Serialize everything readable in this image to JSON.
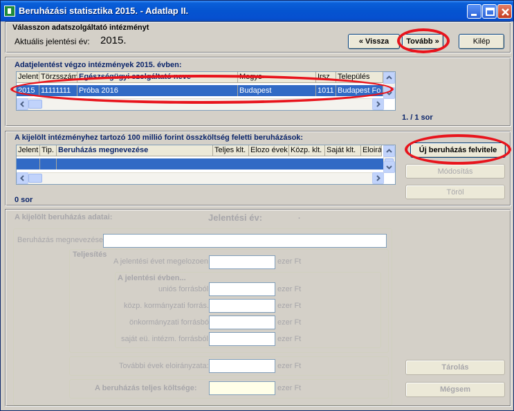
{
  "window": {
    "title": "Beruházási statisztika 2015. - Adatlap II."
  },
  "top": {
    "prompt": "Válasszon adatszolgáltató intézményt",
    "year_label": "Aktuális jelentési év:",
    "year_value": "2015.",
    "back_button": "« Vissza",
    "next_button": "Tovább »",
    "exit_button": "Kilép"
  },
  "institutions": {
    "title": "Adatjelentést végzo intézmények  2015. évben:",
    "columns": [
      "Jelent",
      "Törzsszám",
      "Egészségügyi szolgáltató neve",
      "Megye",
      "Irsz",
      "Település"
    ],
    "rows": [
      [
        "2015",
        "11111111",
        "Próba 2016",
        "Budapest",
        "1011",
        "Budapest Fo"
      ]
    ],
    "count": "1. / 1 sor"
  },
  "investments": {
    "title": "A kijelölt intézményhez tartozó 100 millió forint összköltség feletti beruházások:",
    "columns": [
      "Jelent",
      "Tip.",
      "Beruházás megnevezése",
      "Teljes klt.",
      "Elozo évek",
      "Közp. klt.",
      "Saját klt.",
      "Eloirá"
    ],
    "count": "0 sor",
    "new_button": "Új beruházás felvitele",
    "modify_button": "Módosítás",
    "delete_button": "Töröl"
  },
  "details": {
    "title": "A kijelölt beruházás adatai:",
    "year_label": "Jelentési év:",
    "year_value": ".",
    "name_label": "Beruházás megnevezése:",
    "fulfilment_label": "Teljesítés",
    "prior_label": "A jelentési évet megelozoen:",
    "in_year_label": "A jelentési évben...",
    "eu_label": "uniós forrásból:",
    "central_label": "közp. kormányzati forrás.:",
    "local_label": "önkormányzati forrásból:",
    "own_label": "saját eü. intézm. forrásból:",
    "future_label": "További évek eloirányzata:",
    "total_label": "A beruházás teljes költsége:",
    "unit": "ezer Ft",
    "save_button": "Tárolás",
    "cancel_button": "Mégsem"
  }
}
